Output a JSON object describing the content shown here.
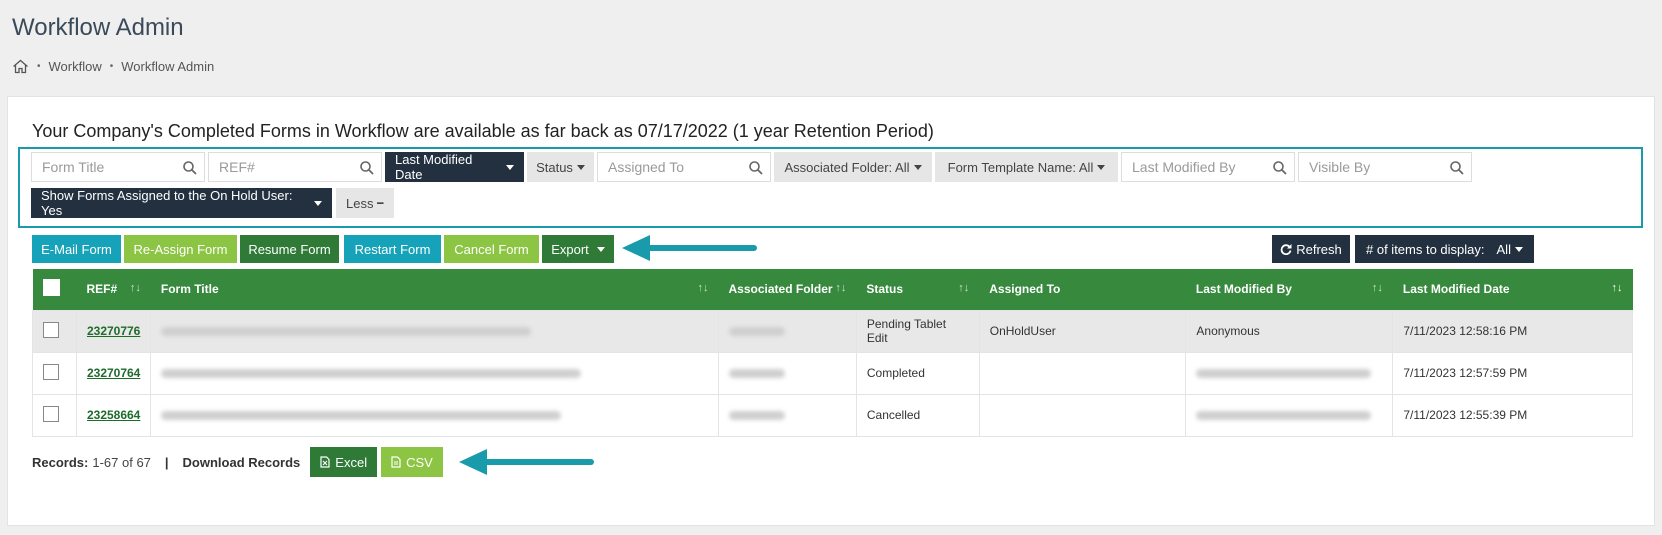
{
  "page": {
    "title": "Workflow Admin"
  },
  "breadcrumb": {
    "items": [
      "Workflow",
      "Workflow Admin"
    ]
  },
  "retention_text": "Your Company's Completed Forms in Workflow are available as far back as 07/17/2022 (1 year Retention Period)",
  "filters": {
    "form_title_placeholder": "Form Title",
    "ref_placeholder": "REF#",
    "last_modified_date": "Last Modified Date",
    "status": "Status",
    "assigned_to_placeholder": "Assigned To",
    "associated_folder": "Associated Folder: All",
    "form_template_name": "Form Template Name: All",
    "last_modified_by_placeholder": "Last Modified By",
    "visible_by_placeholder": "Visible By",
    "on_hold": "Show Forms Assigned to the On Hold User: Yes",
    "less": "Less"
  },
  "actions": {
    "email": "E-Mail Form",
    "reassign": "Re-Assign Form",
    "resume": "Resume Form",
    "restart": "Restart Form",
    "cancel": "Cancel Form",
    "export": "Export",
    "refresh": "Refresh",
    "items_display_label": "# of items to display:",
    "items_display_value": "All"
  },
  "table": {
    "columns": [
      "REF#",
      "Form Title",
      "Associated Folder",
      "Status",
      "Assigned To",
      "Last Modified By",
      "Last Modified Date"
    ],
    "rows": [
      {
        "ref": "23270776",
        "status": "Pending Tablet Edit",
        "assigned_to": "OnHoldUser",
        "modified_by": "Anonymous",
        "modified_date": "7/11/2023 12:58:16 PM"
      },
      {
        "ref": "23270764",
        "status": "Completed",
        "assigned_to": "",
        "modified_by": "",
        "modified_date": "7/11/2023 12:57:59 PM"
      },
      {
        "ref": "23258664",
        "status": "Cancelled",
        "assigned_to": "",
        "modified_by": "",
        "modified_date": "7/11/2023 12:55:39 PM"
      }
    ]
  },
  "footer": {
    "records_label": "Records:",
    "records_value": "1-67 of 67",
    "divider": "|",
    "download_label": "Download Records",
    "excel": "Excel",
    "csv": "CSV"
  },
  "colors": {
    "header_green": "#37893d",
    "teal": "#16a2b8",
    "lime": "#8cc443",
    "dark_green": "#2f7a37",
    "navy": "#223040"
  },
  "icons": [
    "home-icon",
    "search-icon",
    "caret-down-icon",
    "minus-icon",
    "refresh-icon",
    "sort-icon",
    "excel-file-icon",
    "csv-file-icon",
    "arrow-icon"
  ]
}
